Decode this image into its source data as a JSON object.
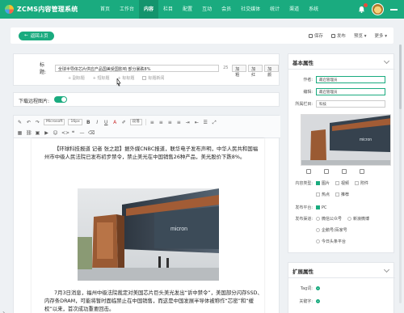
{
  "app": {
    "title": "ZCMS内容管理系统"
  },
  "nav": [
    "首页",
    "工作台",
    "内容",
    "栏目",
    "配置",
    "互动",
    "会员",
    "社交媒体",
    "统计",
    "渠道",
    "系统"
  ],
  "nav_active_index": 2,
  "colors": {
    "brand": "#1aab7f",
    "brand_dark": "#14946d"
  },
  "actionbar": {
    "back": "返回上页",
    "save": "保存",
    "publish": "发布",
    "preview": "预览",
    "more": "更多"
  },
  "title_form": {
    "label": "标题:",
    "value": "全球半导体芯片供应产品国美受国影响 部分暴跌8%",
    "count": "25",
    "btn_bold": "加粗",
    "btn_italic": "加红",
    "btn_color": "加颜",
    "options": [
      "+ 副标题",
      "+ 短标题",
      "+ 标标题",
      "标题新闻"
    ]
  },
  "remote": {
    "label": "下载远程图片:"
  },
  "toolbar": {
    "font": "Microsoft",
    "size": "16px",
    "heading": "段落"
  },
  "article": {
    "p1": "【环球科技报道 记者 张之超】据外媒CNBC报道，联华电子发布声明，中华人民共和国福州市中级人民法院已发布初步禁令，禁止美光在中国销售26种产品，美光股价下跌8%。",
    "p2": "7月3日消息，福州中级法院裁定对美国芯片巨头美光发出“诉中禁令”，美国部分闪存SSD、内存条DRAM，可能将暂时面临禁止在中国销售，而这是中国发展半导体被称作“芯密”和“缓权”以来，首次成功重要回击。"
  },
  "props": {
    "heading": "基本属性",
    "author_label": "作者:",
    "author_value": "最启管理员",
    "editor_label": "编辑:",
    "editor_value": "最启管理员",
    "column_label": "所属栏目:",
    "column_value": "科技",
    "content_type_label": "内容类型:",
    "content_types": [
      "图片",
      "视频",
      "附件"
    ],
    "content_types_2": [
      "热点",
      "推荐"
    ],
    "platform_label": "发布平台:",
    "platform": "PC",
    "channel_label": "发布渠道:",
    "channels": [
      "微信公众号",
      "新浪微博"
    ],
    "channels_2": [
      "企鹅号/百家号"
    ],
    "channels_3": [
      "今日头条平台"
    ]
  },
  "ext": {
    "heading": "扩展属性",
    "tag_label": "Tag词:",
    "keyword_label": "关键字:"
  }
}
